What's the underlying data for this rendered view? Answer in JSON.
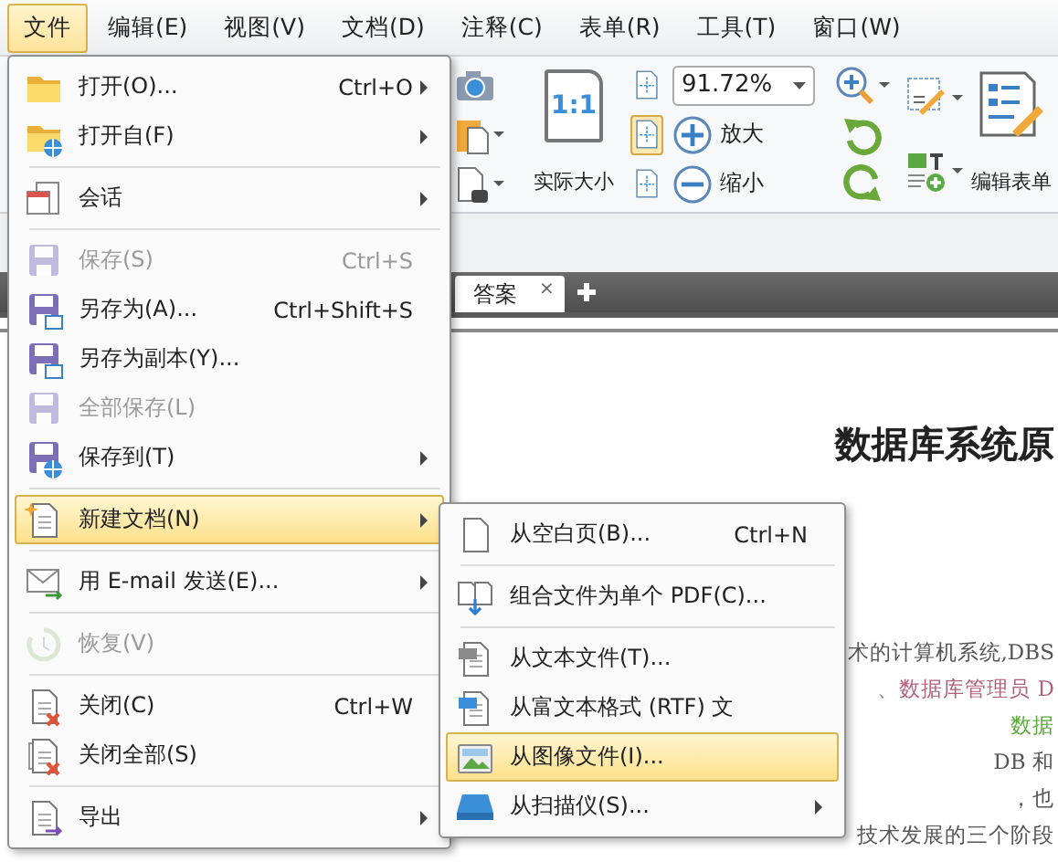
{
  "menubar": [
    {
      "label": "文件",
      "selected": true
    },
    {
      "label": "编辑(E)",
      "selected": false
    },
    {
      "label": "视图(V)",
      "selected": false
    },
    {
      "label": "文档(D)",
      "selected": false
    },
    {
      "label": "注释(C)",
      "selected": false
    },
    {
      "label": "表单(R)",
      "selected": false
    },
    {
      "label": "工具(T)",
      "selected": false
    },
    {
      "label": "窗口(W)",
      "selected": false
    }
  ],
  "toolbar": {
    "actual_size": {
      "glyph": "1:1",
      "label": "实际大小"
    },
    "fit_buttons": [
      {
        "selected": false
      },
      {
        "selected": true
      },
      {
        "selected": false
      }
    ],
    "zoom": {
      "value": "91.72%"
    },
    "zoom_in": "放大",
    "zoom_out": "缩小",
    "edit_form": "编辑表单"
  },
  "tabs": [
    {
      "label": "答案",
      "close": "×",
      "selected": true
    }
  ],
  "document": {
    "title": "数据库系统原",
    "lines": [
      {
        "text": "术的计算机系统,DBS",
        "color": "#555555"
      },
      {
        "text": "、数据库管理员 D",
        "color": "#b0607a"
      },
      {
        "text": "数据",
        "color": "#5aa83a"
      },
      {
        "text": "DB 和",
        "color": "#555555"
      },
      {
        "text": "，也",
        "color": "#555555"
      },
      {
        "text": "技术发展的三个阶段",
        "color": "#555555"
      }
    ]
  },
  "file_menu": [
    {
      "kind": "item",
      "label": "打开(O)...",
      "shortcut": "Ctrl+O",
      "has_submenu": true,
      "disabled": false,
      "selected": false
    },
    {
      "kind": "item",
      "label": "打开自(F)",
      "has_submenu": true,
      "disabled": false,
      "selected": false
    },
    {
      "kind": "separator"
    },
    {
      "kind": "item",
      "label": "会话",
      "has_submenu": true,
      "disabled": false,
      "selected": false
    },
    {
      "kind": "separator"
    },
    {
      "kind": "item",
      "label": "保存(S)",
      "shortcut": "Ctrl+S",
      "has_submenu": false,
      "disabled": true,
      "selected": false
    },
    {
      "kind": "item",
      "label": "另存为(A)...",
      "shortcut": "Ctrl+Shift+S",
      "has_submenu": false,
      "disabled": false,
      "selected": false
    },
    {
      "kind": "item",
      "label": "另存为副本(Y)...",
      "has_submenu": false,
      "disabled": false,
      "selected": false
    },
    {
      "kind": "item",
      "label": "全部保存(L)",
      "has_submenu": false,
      "disabled": true,
      "selected": false
    },
    {
      "kind": "item",
      "label": "保存到(T)",
      "has_submenu": true,
      "disabled": false,
      "selected": false
    },
    {
      "kind": "separator"
    },
    {
      "kind": "item",
      "label": "新建文档(N)",
      "has_submenu": true,
      "disabled": false,
      "selected": true
    },
    {
      "kind": "separator"
    },
    {
      "kind": "item",
      "label": "用 E-mail 发送(E)...",
      "has_submenu": true,
      "disabled": false,
      "selected": false
    },
    {
      "kind": "separator"
    },
    {
      "kind": "item",
      "label": "恢复(V)",
      "has_submenu": false,
      "disabled": true,
      "selected": false
    },
    {
      "kind": "separator"
    },
    {
      "kind": "item",
      "label": "关闭(C)",
      "shortcut": "Ctrl+W",
      "has_submenu": false,
      "disabled": false,
      "selected": false
    },
    {
      "kind": "item",
      "label": "关闭全部(S)",
      "has_submenu": false,
      "disabled": false,
      "selected": false
    },
    {
      "kind": "separator"
    },
    {
      "kind": "item",
      "label": "导出",
      "has_submenu": true,
      "disabled": false,
      "selected": false
    }
  ],
  "new_document_submenu": [
    {
      "kind": "item",
      "label": "从空白页(B)...",
      "shortcut": "Ctrl+N",
      "has_submenu": false,
      "disabled": false,
      "selected": false
    },
    {
      "kind": "separator"
    },
    {
      "kind": "item",
      "label": "组合文件为单个 PDF(C)...",
      "has_submenu": false,
      "disabled": false,
      "selected": false
    },
    {
      "kind": "separator"
    },
    {
      "kind": "item",
      "label": "从文本文件(T)...",
      "has_submenu": false,
      "disabled": false,
      "selected": false
    },
    {
      "kind": "item",
      "label": "从富文本格式 (RTF) 文",
      "has_submenu": false,
      "disabled": false,
      "selected": false
    },
    {
      "kind": "item",
      "label": "从图像文件(I)...",
      "has_submenu": false,
      "disabled": false,
      "selected": true
    },
    {
      "kind": "item",
      "label": "从扫描仪(S)...",
      "has_submenu": true,
      "disabled": false,
      "selected": false
    }
  ]
}
